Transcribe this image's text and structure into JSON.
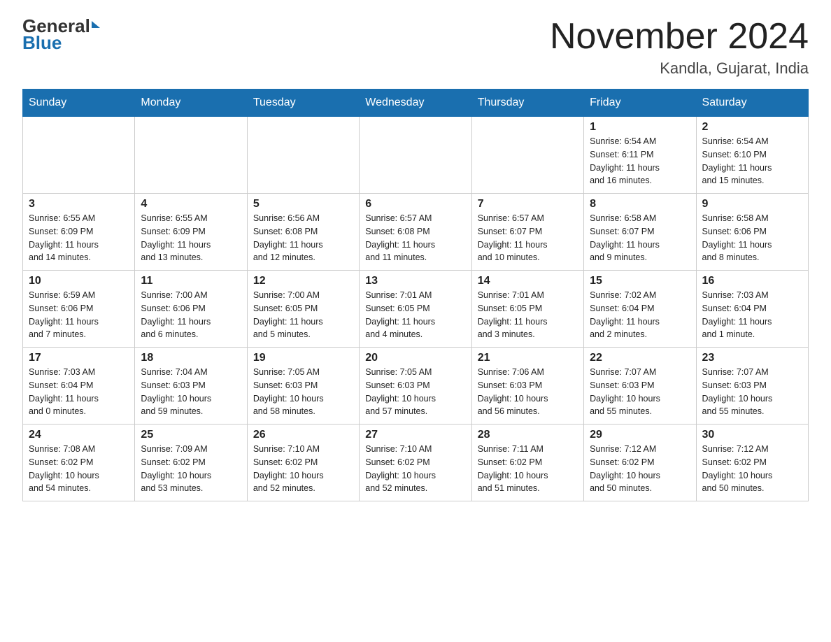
{
  "logo": {
    "general": "General",
    "blue": "Blue",
    "logo_line2": "Blue"
  },
  "header": {
    "month_title": "November 2024",
    "location": "Kandla, Gujarat, India"
  },
  "weekdays": [
    "Sunday",
    "Monday",
    "Tuesday",
    "Wednesday",
    "Thursday",
    "Friday",
    "Saturday"
  ],
  "weeks": [
    [
      {
        "day": "",
        "info": ""
      },
      {
        "day": "",
        "info": ""
      },
      {
        "day": "",
        "info": ""
      },
      {
        "day": "",
        "info": ""
      },
      {
        "day": "",
        "info": ""
      },
      {
        "day": "1",
        "info": "Sunrise: 6:54 AM\nSunset: 6:11 PM\nDaylight: 11 hours\nand 16 minutes."
      },
      {
        "day": "2",
        "info": "Sunrise: 6:54 AM\nSunset: 6:10 PM\nDaylight: 11 hours\nand 15 minutes."
      }
    ],
    [
      {
        "day": "3",
        "info": "Sunrise: 6:55 AM\nSunset: 6:09 PM\nDaylight: 11 hours\nand 14 minutes."
      },
      {
        "day": "4",
        "info": "Sunrise: 6:55 AM\nSunset: 6:09 PM\nDaylight: 11 hours\nand 13 minutes."
      },
      {
        "day": "5",
        "info": "Sunrise: 6:56 AM\nSunset: 6:08 PM\nDaylight: 11 hours\nand 12 minutes."
      },
      {
        "day": "6",
        "info": "Sunrise: 6:57 AM\nSunset: 6:08 PM\nDaylight: 11 hours\nand 11 minutes."
      },
      {
        "day": "7",
        "info": "Sunrise: 6:57 AM\nSunset: 6:07 PM\nDaylight: 11 hours\nand 10 minutes."
      },
      {
        "day": "8",
        "info": "Sunrise: 6:58 AM\nSunset: 6:07 PM\nDaylight: 11 hours\nand 9 minutes."
      },
      {
        "day": "9",
        "info": "Sunrise: 6:58 AM\nSunset: 6:06 PM\nDaylight: 11 hours\nand 8 minutes."
      }
    ],
    [
      {
        "day": "10",
        "info": "Sunrise: 6:59 AM\nSunset: 6:06 PM\nDaylight: 11 hours\nand 7 minutes."
      },
      {
        "day": "11",
        "info": "Sunrise: 7:00 AM\nSunset: 6:06 PM\nDaylight: 11 hours\nand 6 minutes."
      },
      {
        "day": "12",
        "info": "Sunrise: 7:00 AM\nSunset: 6:05 PM\nDaylight: 11 hours\nand 5 minutes."
      },
      {
        "day": "13",
        "info": "Sunrise: 7:01 AM\nSunset: 6:05 PM\nDaylight: 11 hours\nand 4 minutes."
      },
      {
        "day": "14",
        "info": "Sunrise: 7:01 AM\nSunset: 6:05 PM\nDaylight: 11 hours\nand 3 minutes."
      },
      {
        "day": "15",
        "info": "Sunrise: 7:02 AM\nSunset: 6:04 PM\nDaylight: 11 hours\nand 2 minutes."
      },
      {
        "day": "16",
        "info": "Sunrise: 7:03 AM\nSunset: 6:04 PM\nDaylight: 11 hours\nand 1 minute."
      }
    ],
    [
      {
        "day": "17",
        "info": "Sunrise: 7:03 AM\nSunset: 6:04 PM\nDaylight: 11 hours\nand 0 minutes."
      },
      {
        "day": "18",
        "info": "Sunrise: 7:04 AM\nSunset: 6:03 PM\nDaylight: 10 hours\nand 59 minutes."
      },
      {
        "day": "19",
        "info": "Sunrise: 7:05 AM\nSunset: 6:03 PM\nDaylight: 10 hours\nand 58 minutes."
      },
      {
        "day": "20",
        "info": "Sunrise: 7:05 AM\nSunset: 6:03 PM\nDaylight: 10 hours\nand 57 minutes."
      },
      {
        "day": "21",
        "info": "Sunrise: 7:06 AM\nSunset: 6:03 PM\nDaylight: 10 hours\nand 56 minutes."
      },
      {
        "day": "22",
        "info": "Sunrise: 7:07 AM\nSunset: 6:03 PM\nDaylight: 10 hours\nand 55 minutes."
      },
      {
        "day": "23",
        "info": "Sunrise: 7:07 AM\nSunset: 6:03 PM\nDaylight: 10 hours\nand 55 minutes."
      }
    ],
    [
      {
        "day": "24",
        "info": "Sunrise: 7:08 AM\nSunset: 6:02 PM\nDaylight: 10 hours\nand 54 minutes."
      },
      {
        "day": "25",
        "info": "Sunrise: 7:09 AM\nSunset: 6:02 PM\nDaylight: 10 hours\nand 53 minutes."
      },
      {
        "day": "26",
        "info": "Sunrise: 7:10 AM\nSunset: 6:02 PM\nDaylight: 10 hours\nand 52 minutes."
      },
      {
        "day": "27",
        "info": "Sunrise: 7:10 AM\nSunset: 6:02 PM\nDaylight: 10 hours\nand 52 minutes."
      },
      {
        "day": "28",
        "info": "Sunrise: 7:11 AM\nSunset: 6:02 PM\nDaylight: 10 hours\nand 51 minutes."
      },
      {
        "day": "29",
        "info": "Sunrise: 7:12 AM\nSunset: 6:02 PM\nDaylight: 10 hours\nand 50 minutes."
      },
      {
        "day": "30",
        "info": "Sunrise: 7:12 AM\nSunset: 6:02 PM\nDaylight: 10 hours\nand 50 minutes."
      }
    ]
  ]
}
